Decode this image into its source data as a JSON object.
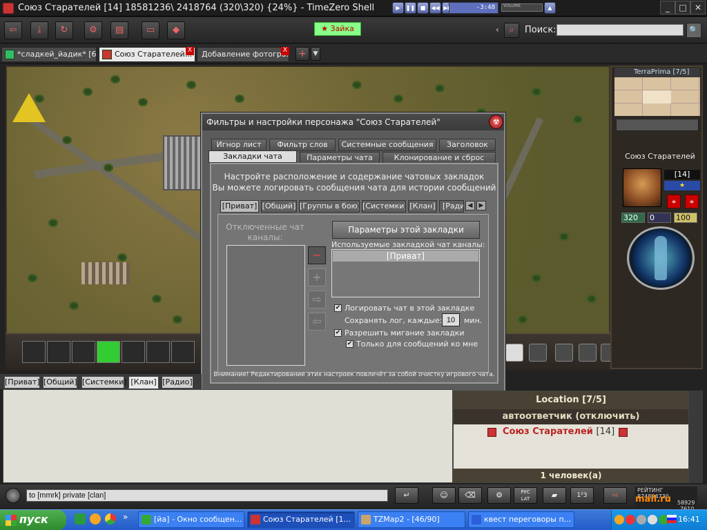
{
  "window": {
    "title": "Союз Старателей [14] 18581236\\ 2418764  (320\\320) {24%} - TimeZero Shell",
    "player_time": "-3:48",
    "volume_label": "VOLUME",
    "controls": {
      "minimize": "_",
      "maximize": "□",
      "close": "✕"
    }
  },
  "toolbar": {
    "friend_button": "Зайка",
    "search_label": "Поиск:",
    "search_value": "",
    "buttons": [
      "back-icon",
      "download-icon",
      "refresh-icon",
      "auto-icon",
      "book-icon",
      "window-icon",
      "cube-icon"
    ]
  },
  "tabs": [
    {
      "label": "*сладкей_йадик* [6]",
      "active": false
    },
    {
      "label": "Союз Старателей...",
      "active": true
    },
    {
      "label": "Добавление фотогра...",
      "active": false
    }
  ],
  "minimap": {
    "title": "TerraPrima [7/5]"
  },
  "character": {
    "name": "Союз Старателей",
    "level": "[14]",
    "hp": "320",
    "stat2": "0",
    "stat3": "100"
  },
  "dialog": {
    "title": "Фильтры и настройки персонажа \"Союз Старателей\"",
    "tabs_row1": [
      "Игнор лист",
      "Фильтр слов",
      "Системные сообщения",
      "Заголовок"
    ],
    "tabs_row2": [
      "Закладки чата",
      "Параметры чата",
      "Клонирование и сброс"
    ],
    "intro_line1": "Настройте расположение и содержание чатовых закладок",
    "intro_line2": "Вы можете логировать сообщения чата для истории сообщений",
    "inner_tabs": [
      "[Приват]",
      "[Общий]",
      "[Группы в бою]",
      "[Системки]",
      "[Клан]",
      "[Радио"
    ],
    "disabled_channels_label": "Отключенные чат каналы:",
    "params_button": "Параметры этой закладки",
    "used_channels_label": "Используемые закладкой чат каналы:",
    "used_channels": [
      "[Приват]"
    ],
    "log_checkbox": "Логировать чат в этой закладке",
    "save_log_label": "Сохранять лог, каждые:",
    "save_log_value": "10",
    "save_log_unit": "мин.",
    "blink_checkbox": "Разрешить мигание закладки",
    "only_me_checkbox": "Только для сообщений ко мне",
    "warning": "Внимание! Редактирование этих настроек повлечёт за собой очистку игрового чата."
  },
  "chat_tabs": [
    {
      "label": "[Приват]",
      "active": false
    },
    {
      "label": "[Общий]",
      "active": false
    },
    {
      "label": "[Системки]",
      "active": false
    },
    {
      "label": "[Клан]",
      "active": true
    },
    {
      "label": "[Радио]",
      "active": false
    }
  ],
  "location": {
    "title": "Location [7/5]",
    "autoresponder": "автоответчик (отключить)",
    "member_name": "Союз Старателей",
    "member_level": "[14]",
    "footer": "1 человек(а)"
  },
  "input": {
    "chat_value": "to [mmrk] private [clan]",
    "translit_button": "РУС\nLAT"
  },
  "rating": {
    "label": "РЕЙТИНГ",
    "value1": "874894730",
    "value2": "58929",
    "value3": "7610",
    "brand": "mail.ru"
  },
  "taskbar": {
    "start": "пуск",
    "tasks": [
      {
        "label": "[йа] - Окно сообщен...",
        "active": false
      },
      {
        "label": "Союз Старателей [1...",
        "active": true
      },
      {
        "label": "TZMap2 - [46/90]",
        "active": false
      },
      {
        "label": "квест переговоры п...",
        "active": false
      }
    ],
    "clock": "16:41"
  },
  "colors": {
    "accent": "#c33333",
    "dialog_bg": "#5b5b5b",
    "taskbar": "#245ccb"
  }
}
